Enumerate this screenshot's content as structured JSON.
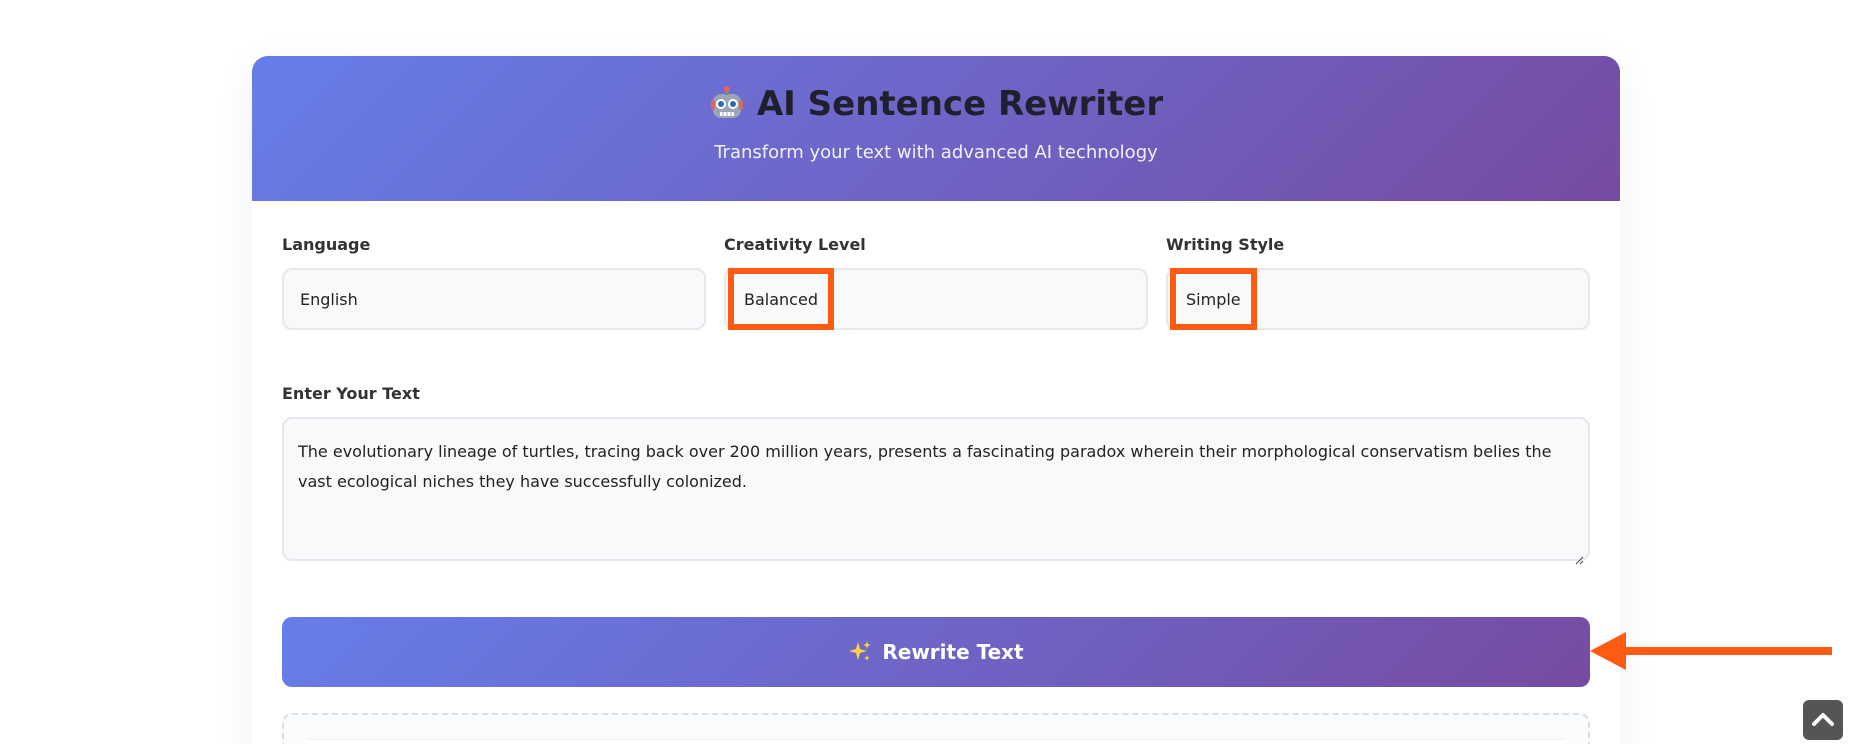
{
  "header": {
    "icon": "robot-icon",
    "title": "AI Sentence Rewriter",
    "subtitle": "Transform your text with advanced AI technology"
  },
  "controls": {
    "language": {
      "label": "Language",
      "value": "English"
    },
    "creativity": {
      "label": "Creativity Level",
      "value": "Balanced"
    },
    "style": {
      "label": "Writing Style",
      "value": "Simple"
    }
  },
  "input": {
    "label": "Enter Your Text",
    "value": "The evolutionary lineage of turtles, tracing back over 200 million years, presents a fascinating paradox wherein their morphological conservatism belies the vast ecological niches they have successfully colonized."
  },
  "action": {
    "icon": "sparkle-icon",
    "label": "Rewrite Text"
  },
  "colors": {
    "gradient_start": "#667eea",
    "gradient_end": "#764ba2",
    "highlight": "#ff5a12"
  }
}
